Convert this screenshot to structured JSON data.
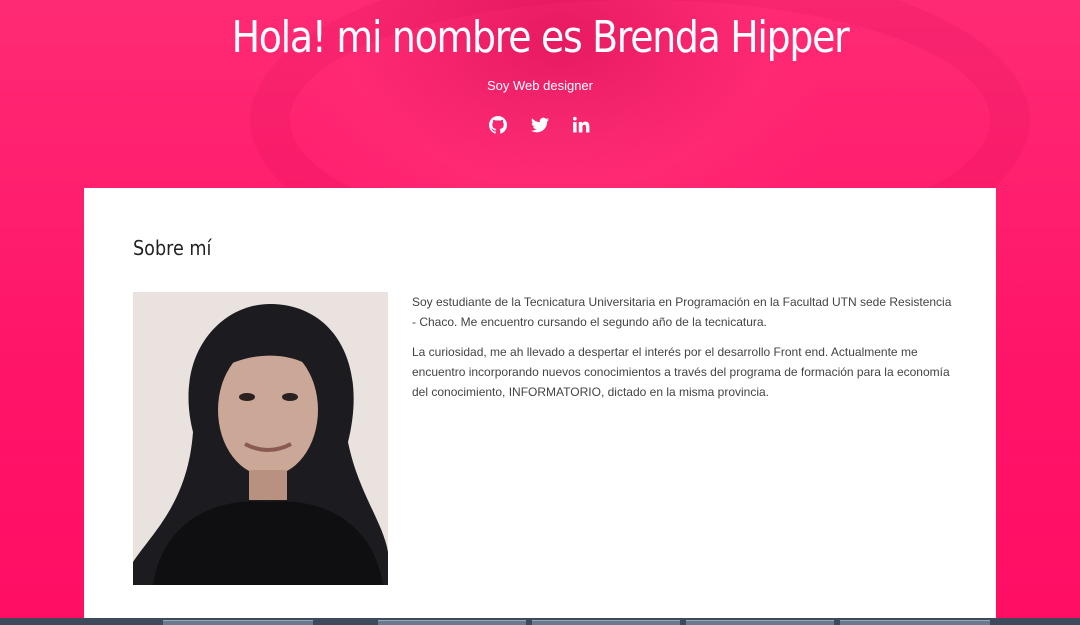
{
  "header": {
    "title": "Hola! mi nombre es Brenda Hipper",
    "subtitle": "Soy Web designer",
    "socials": [
      {
        "name": "github-icon"
      },
      {
        "name": "twitter-icon"
      },
      {
        "name": "linkedin-icon"
      }
    ]
  },
  "about": {
    "title": "Sobre mí",
    "paragraphs": [
      "Soy estudiante de la Tecnicatura Universitaria en Programación en la Facultad UTN sede Resistencia - Chaco. Me encuentro cursando el segundo año de la tecnicatura.",
      "La curiosidad, me ah llevado a despertar el interés por el desarrollo Front end. Actualmente me encuentro incorporando nuevos conocimientos a través del programa de formación para la economía del conocimiento, INFORMATORIO, dictado en la misma provincia."
    ]
  },
  "colors": {
    "accent": "#ff1f6e",
    "card": "#ffffff",
    "text": "#444444"
  }
}
